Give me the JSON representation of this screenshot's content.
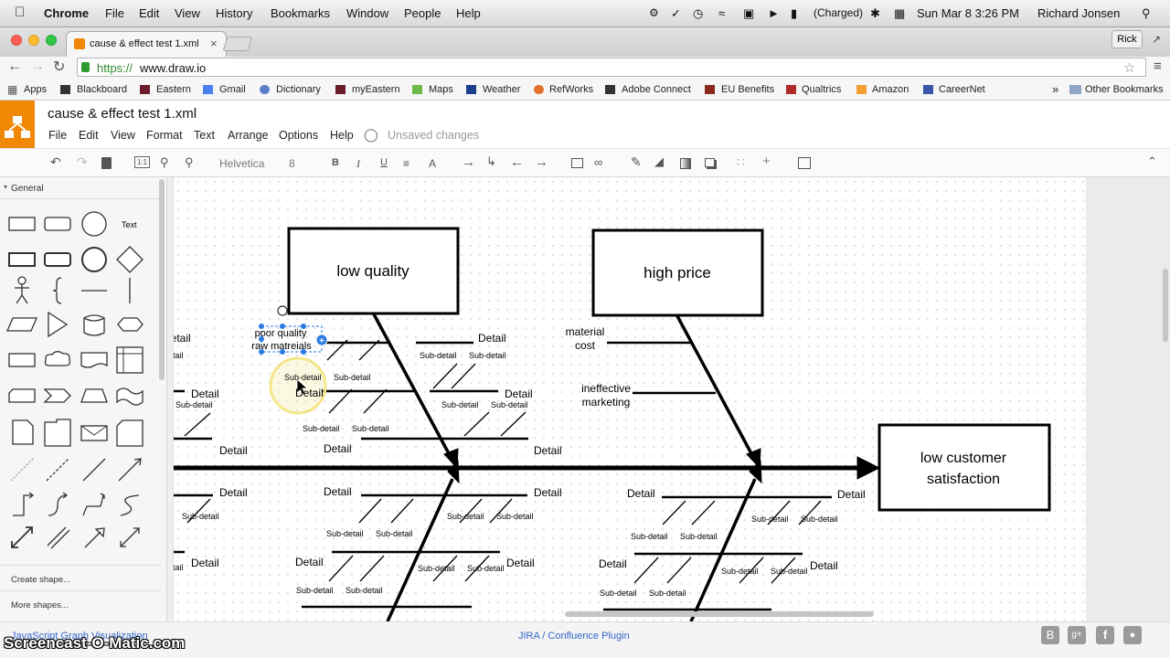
{
  "menubar": {
    "apple": "",
    "app": "Chrome",
    "items": [
      "File",
      "Edit",
      "View",
      "History",
      "Bookmarks",
      "Window",
      "People",
      "Help"
    ],
    "battery": "(Charged)",
    "datetime": "Sun Mar 8  3:26 PM",
    "user": "Richard Jonsen"
  },
  "browser": {
    "tab_title": "cause & effect test 1.xml",
    "profile": "Rick",
    "url_scheme": "https://",
    "url_host": "www.draw.io",
    "bookmarks": [
      "Apps",
      "Blackboard",
      "Eastern",
      "Gmail",
      "Dictionary",
      "myEastern",
      "Maps",
      "Weather",
      "RefWorks",
      "Adobe Connect",
      "EU Benefits",
      "Qualtrics",
      "Amazon",
      "CareerNet"
    ],
    "overflow": "»",
    "other_bookmarks": "Other Bookmarks"
  },
  "app": {
    "file_title": "cause & effect test 1.xml",
    "menu": [
      "File",
      "Edit",
      "View",
      "Format",
      "Text",
      "Arrange",
      "Options",
      "Help"
    ],
    "status": "Unsaved changes",
    "font_name": "Helvetica",
    "font_size": "8",
    "zoom_reset": "1:1"
  },
  "sidebar": {
    "section": "General",
    "text_shape": "Text",
    "create_shape": "Create shape...",
    "more_shapes": "More shapes..."
  },
  "footer": {
    "left_link": "JavaScript Graph Visualization",
    "center_link": "JIRA / Confluence Plugin",
    "watermark": "Screencast-O-Matic.com"
  },
  "diagram": {
    "effect": "low customer satisfaction",
    "effect_line1": "low customer",
    "effect_line2": "satisfaction",
    "cause_low_quality": "low quality",
    "cause_high_price": "high price",
    "selected_label_1": "poor quality",
    "selected_label_2": "raw matreials",
    "material_cost_1": "material",
    "material_cost_2": "cost",
    "ineffective_1": "ineffective",
    "ineffective_2": "marketing",
    "detail": "Detail",
    "subdetail": "Sub-detail"
  },
  "colors": {
    "drawio_orange": "#f08705",
    "selection_blue": "#2a7ae2",
    "cursor_ring": "#f3e78a"
  }
}
